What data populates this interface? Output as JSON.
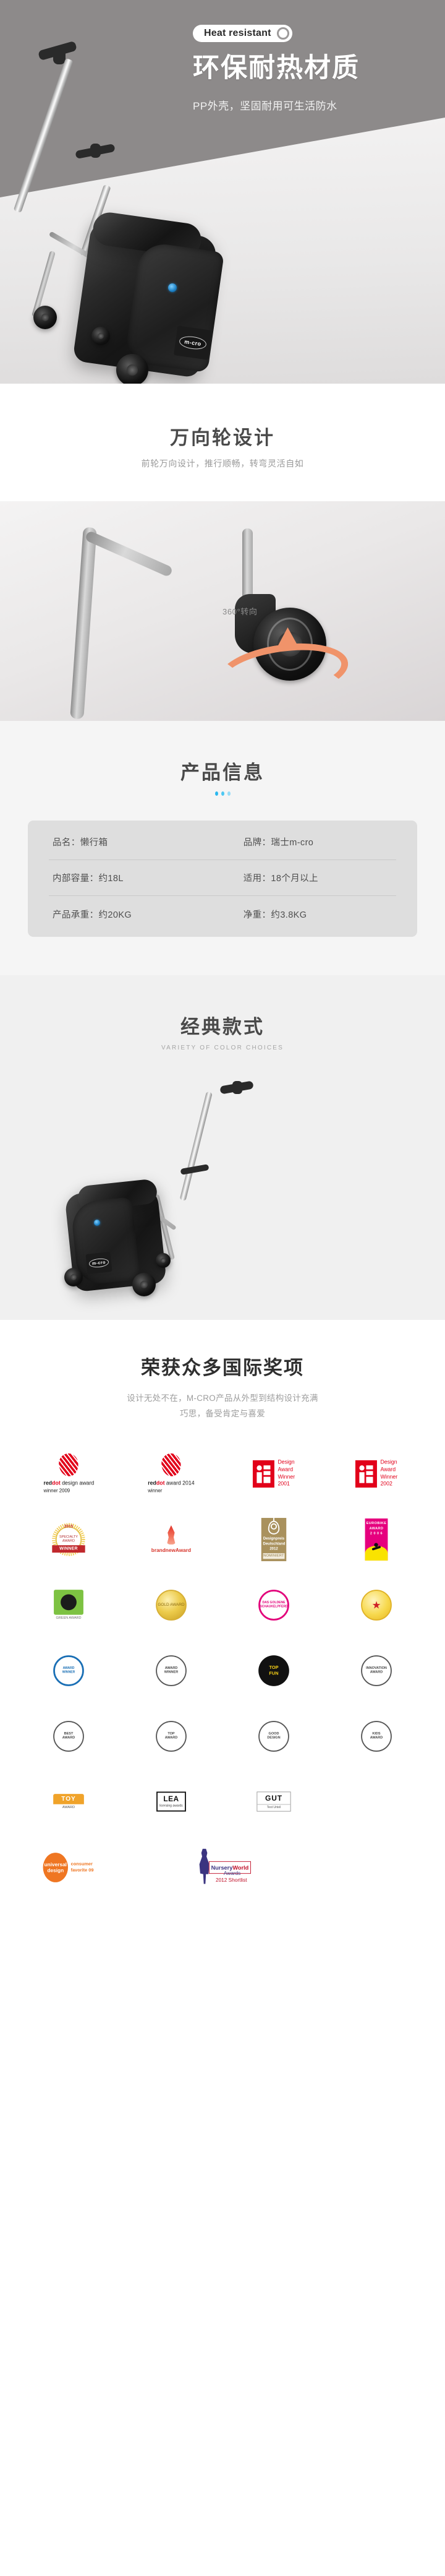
{
  "hero": {
    "pill_label": "Heat resistant",
    "title": "环保耐热材质",
    "subtitle": "PP外壳，坚固耐用可生活防水",
    "bg_color": "#8d8a8a",
    "brand_mark": "m-cro"
  },
  "caster": {
    "title": "万向轮设计",
    "subtitle": "前轮万向设计，推行顺畅，转弯灵活自如",
    "rotation_label": "360°转向",
    "arrow_color": "#f0936a"
  },
  "info": {
    "title": "产品信息",
    "dot_colors": [
      "#2bb8ef",
      "#4ec8f2",
      "#97dcf7"
    ],
    "rows": [
      {
        "left": "品名：懒行箱",
        "right": "品牌：瑞士m-cro"
      },
      {
        "left": "内部容量：约18L",
        "right": "适用：18个月以上"
      },
      {
        "left": "产品承重：约20KG",
        "right": "净重：约3.8KG"
      }
    ]
  },
  "classic": {
    "title": "经典款式",
    "subtitle_en": "VARIETY OF COLOR CHOICES"
  },
  "awards": {
    "title": "荣获众多国际奖项",
    "lead_line1": "设计无处不在，M-CRO产品从外型到结构设计充满",
    "lead_line2": "巧思，备受肯定与喜爱",
    "badges": [
      {
        "id": "reddot-2009",
        "type": "reddot",
        "line1_a": "red",
        "line1_b": "dot",
        "line1_c": " design award",
        "line2": "winner 2009"
      },
      {
        "id": "reddot-2014",
        "type": "reddot",
        "line1_a": "red",
        "line1_b": "dot",
        "line1_c": " award 2014",
        "line2": "winner"
      },
      {
        "id": "if-2001",
        "type": "if",
        "l1": "Design",
        "l2": "Award",
        "l3": "Winner",
        "l4": "2001"
      },
      {
        "id": "if-2002",
        "type": "if",
        "l1": "Design",
        "l2": "Award",
        "l3": "Winner",
        "l4": "2002"
      },
      {
        "id": "specialty-2015",
        "type": "seal",
        "top": "2015",
        "core": "SPECIALTY AWARD",
        "ribbon": "WINNER"
      },
      {
        "id": "brandnew-award",
        "type": "flame",
        "label": "brandnewAward"
      },
      {
        "id": "designpreis-2012",
        "type": "designpreis",
        "l1": "Designpreis",
        "l2": "Deutschland",
        "l3": "2012",
        "nominiert": "NOMINIERT"
      },
      {
        "id": "eurobike-2006",
        "type": "eurobike",
        "l1": "EUROBIKE",
        "l2": "AWARD",
        "l3": "2 0 0 6"
      },
      {
        "id": "green-award",
        "type": "green",
        "caption": "GREEN AWARD"
      },
      {
        "id": "gold-coin-award",
        "type": "coin",
        "label": "GOLD AWARD"
      },
      {
        "id": "goldene-schaukelpferd",
        "type": "pink",
        "l1": "DAS GOLDENE",
        "l2": "SCHAUKELPFERD"
      },
      {
        "id": "star-award",
        "type": "star",
        "glyph": "★"
      },
      {
        "id": "blue-seal-award",
        "type": "blue",
        "l1": "AWARD",
        "l2": "WINNER"
      },
      {
        "id": "circle-award-b",
        "type": "plain",
        "l1": "AWARD",
        "l2": "WINNER"
      },
      {
        "id": "top-fun-award",
        "type": "black",
        "l1": "TOP",
        "l2": "FUN"
      },
      {
        "id": "innovation-award",
        "type": "plain",
        "l1": "INNOVATION",
        "l2": "AWARD"
      },
      {
        "id": "seal-award-a",
        "type": "plain",
        "l1": "BEST",
        "l2": "AWARD"
      },
      {
        "id": "seal-award-b",
        "type": "plain",
        "l1": "TOP",
        "l2": "AWARD"
      },
      {
        "id": "seal-award-c",
        "type": "plain",
        "l1": "GOOD",
        "l2": "DESIGN"
      },
      {
        "id": "seal-award-d",
        "type": "plain",
        "l1": "KIDS",
        "l2": "AWARD"
      },
      {
        "id": "toy-award",
        "type": "toy",
        "top": "TOY",
        "bottom": "AWARD"
      },
      {
        "id": "lea-award",
        "type": "lea",
        "main": "LEA",
        "sub": "licensing awards"
      },
      {
        "id": "gut-award",
        "type": "gut",
        "main": "GUT",
        "sub": "Test Urteil"
      },
      {
        "id": "blank-slot",
        "type": "blank"
      },
      {
        "id": "universal-design-09",
        "type": "universal",
        "l1": "universal",
        "l2": "design",
        "r1": "consumer",
        "r2": "favorite 09"
      },
      {
        "id": "nursery-world-2012",
        "type": "nursery",
        "brand_a": "Nursery",
        "brand_b": "World",
        "awards": "Awards",
        "shortlist": "2012 Shortlist"
      }
    ]
  }
}
